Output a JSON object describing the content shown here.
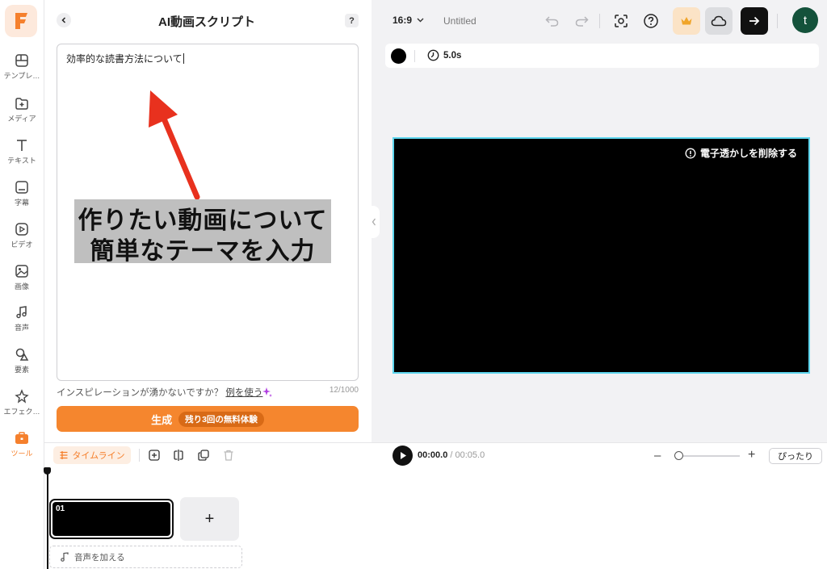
{
  "sidebar": {
    "logo_letter": "F",
    "items": [
      {
        "label": "テンプレ…",
        "icon": "template-icon"
      },
      {
        "label": "メディア",
        "icon": "media-add-icon"
      },
      {
        "label": "テキスト",
        "icon": "text-icon"
      },
      {
        "label": "字幕",
        "icon": "subtitle-icon"
      },
      {
        "label": "ビデオ",
        "icon": "video-icon"
      },
      {
        "label": "画像",
        "icon": "image-icon"
      },
      {
        "label": "音声",
        "icon": "music-icon"
      },
      {
        "label": "要素",
        "icon": "shapes-icon"
      },
      {
        "label": "エフェク…",
        "icon": "effects-icon"
      },
      {
        "label": "ツール",
        "icon": "toolbox-icon",
        "active": true
      }
    ]
  },
  "panel": {
    "title": "AI動画スクリプト",
    "help": "?",
    "script_text": "効率的な読書方法について",
    "annotation_line1": "作りたい動画について",
    "annotation_line2": "簡単なテーマを入力",
    "inspiration_text": "インスピレーションが湧かないですか？",
    "example_link": "例を使う",
    "char_count": "12/1000",
    "generate_label": "生成",
    "trial_badge": "残り3回の無料体験"
  },
  "topbar": {
    "aspect_ratio": "16:9",
    "doc_title": "Untitled",
    "avatar_letter": "t"
  },
  "properties": {
    "duration": "5.0s"
  },
  "canvas": {
    "watermark_label": "電子透かしを削除する"
  },
  "timeline": {
    "tab_label": "タイムライン",
    "current_time": "00:00.0",
    "total_time": " / 00:05.0",
    "fit_label": "ぴったり",
    "clip_number": "01",
    "add_clip": "+",
    "add_audio_label": "音声を加える",
    "zoom_minus": "–",
    "zoom_plus": "+"
  },
  "colors": {
    "accent": "#f5862e",
    "canvas_border": "#5ed6ee",
    "avatar_bg": "#14523b"
  }
}
